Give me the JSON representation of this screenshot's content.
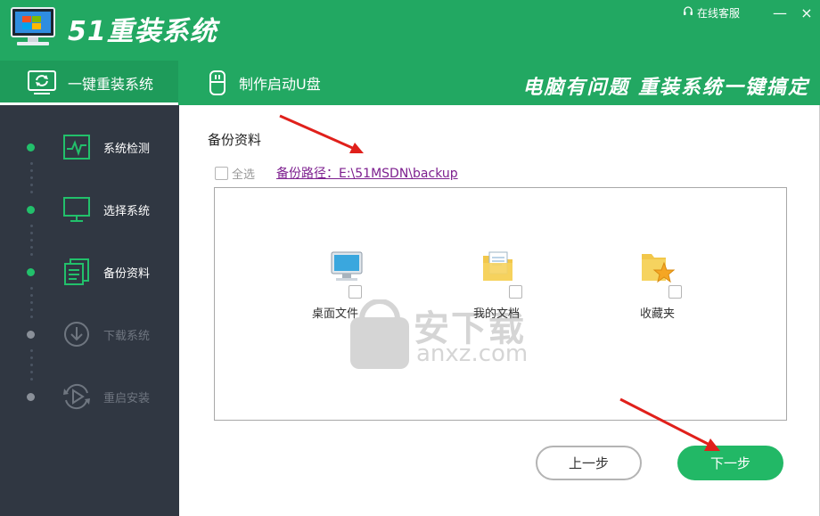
{
  "app": {
    "title": "51重装系统",
    "service_label": "在线客服",
    "minimize_glyph": "—",
    "close_glyph": "×"
  },
  "tabs": [
    {
      "label": "一键重装系统",
      "icon": "refresh-monitor-icon",
      "active": true
    },
    {
      "label": "制作启动U盘",
      "icon": "usb-icon",
      "active": false
    }
  ],
  "slogan": "电脑有问题 重装系统一键搞定",
  "steps": [
    {
      "label": "系统检测",
      "icon": "pulse-monitor-icon",
      "state": "done"
    },
    {
      "label": "选择系统",
      "icon": "monitor-icon",
      "state": "done"
    },
    {
      "label": "备份资料",
      "icon": "documents-icon",
      "state": "done"
    },
    {
      "label": "下载系统",
      "icon": "download-icon",
      "state": "todo"
    },
    {
      "label": "重启安装",
      "icon": "restart-play-icon",
      "state": "todo"
    }
  ],
  "main": {
    "section_title": "备份资料",
    "select_all_label": "全选",
    "backup_path": "备份路径：E:\\51MSDN\\backup",
    "items": [
      {
        "label": "桌面文件",
        "icon": "desktop-computer-icon",
        "checked": false
      },
      {
        "label": "我的文档",
        "icon": "documents-folder-icon",
        "checked": false
      },
      {
        "label": "收藏夹",
        "icon": "favorites-folder-icon",
        "checked": false
      }
    ],
    "prev_label": "上一步",
    "next_label": "下一步"
  },
  "watermark": {
    "text": "安下载",
    "sub": "anxz.com"
  },
  "colors": {
    "brand": "#22a862",
    "sidebar": "#303742",
    "accent_button": "#22b866",
    "path_link": "#7d1f8f",
    "annotation_arrow": "#e0201b"
  }
}
